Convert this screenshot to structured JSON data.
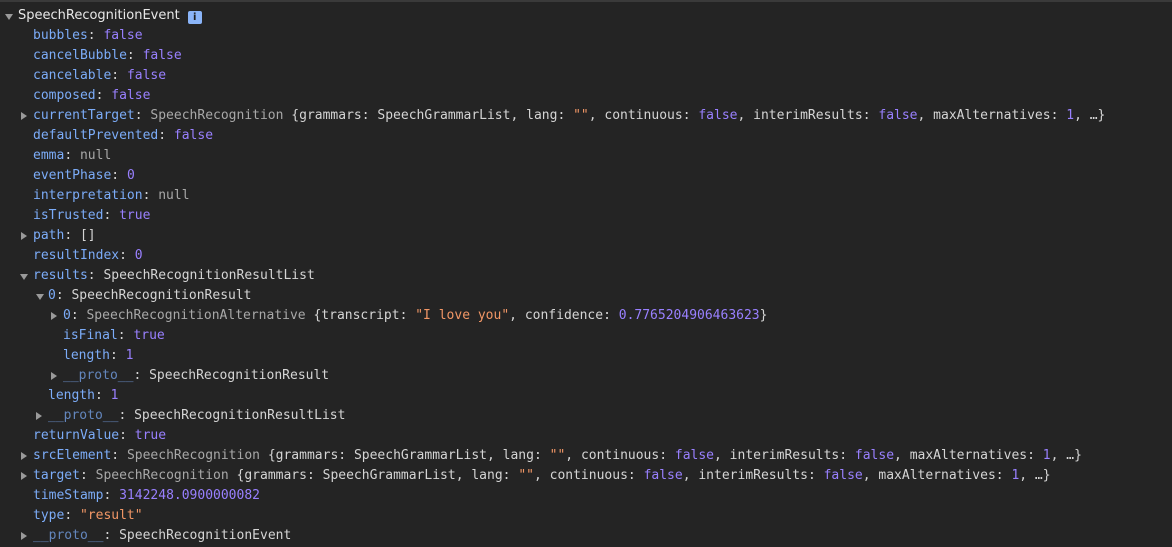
{
  "console": {
    "root": {
      "name": "SpeechRecognitionEvent",
      "info_icon": "i"
    },
    "rows": {
      "bubbles": {
        "key": "bubbles",
        "value": "false"
      },
      "cancelBubble": {
        "key": "cancelBubble",
        "value": "false"
      },
      "cancelable": {
        "key": "cancelable",
        "value": "false"
      },
      "composed": {
        "key": "composed",
        "value": "false"
      },
      "currentTarget": {
        "key": "currentTarget",
        "cls": "SpeechRecognition",
        "open": "{",
        "grammars_key": "grammars",
        "grammars_val": "SpeechGrammarList",
        "lang_key": "lang",
        "lang_val": "\"\"",
        "continuous_key": "continuous",
        "continuous_val": "false",
        "interim_key": "interimResults",
        "interim_val": "false",
        "maxalt_key": "maxAlternatives",
        "maxalt_val": "1",
        "tail": ", …}"
      },
      "defaultPrevented": {
        "key": "defaultPrevented",
        "value": "false"
      },
      "emma": {
        "key": "emma",
        "value": "null"
      },
      "eventPhase": {
        "key": "eventPhase",
        "value": "0"
      },
      "interpretation": {
        "key": "interpretation",
        "value": "null"
      },
      "isTrusted": {
        "key": "isTrusted",
        "value": "true"
      },
      "path": {
        "key": "path",
        "value": "[]"
      },
      "resultIndex": {
        "key": "resultIndex",
        "value": "0"
      },
      "results": {
        "key": "results",
        "value": "SpeechRecognitionResultList"
      },
      "result0": {
        "key": "0",
        "value": "SpeechRecognitionResult"
      },
      "alt0": {
        "key": "0",
        "cls": "SpeechRecognitionAlternative",
        "open": "{",
        "transcript_key": "transcript",
        "transcript_val": "\"I love you\"",
        "confidence_key": "confidence",
        "confidence_val": "0.7765204906463623",
        "close": "}"
      },
      "isFinal": {
        "key": "isFinal",
        "value": "true"
      },
      "length_inner": {
        "key": "length",
        "value": "1"
      },
      "proto_result": {
        "key": "__proto__",
        "value": "SpeechRecognitionResult"
      },
      "length_list": {
        "key": "length",
        "value": "1"
      },
      "proto_list": {
        "key": "__proto__",
        "value": "SpeechRecognitionResultList"
      },
      "returnValue": {
        "key": "returnValue",
        "value": "true"
      },
      "srcElement": {
        "key": "srcElement",
        "cls": "SpeechRecognition",
        "open": "{",
        "grammars_key": "grammars",
        "grammars_val": "SpeechGrammarList",
        "lang_key": "lang",
        "lang_val": "\"\"",
        "continuous_key": "continuous",
        "continuous_val": "false",
        "interim_key": "interimResults",
        "interim_val": "false",
        "maxalt_key": "maxAlternatives",
        "maxalt_val": "1",
        "tail": ", …}"
      },
      "target": {
        "key": "target",
        "cls": "SpeechRecognition",
        "open": "{",
        "grammars_key": "grammars",
        "grammars_val": "SpeechGrammarList",
        "lang_key": "lang",
        "lang_val": "\"\"",
        "continuous_key": "continuous",
        "continuous_val": "false",
        "interim_key": "interimResults",
        "interim_val": "false",
        "maxalt_key": "maxAlternatives",
        "maxalt_val": "1",
        "tail": ", …}"
      },
      "timeStamp": {
        "key": "timeStamp",
        "value": "3142248.0900000082"
      },
      "type": {
        "key": "type",
        "value": "\"result\""
      },
      "proto_event": {
        "key": "__proto__",
        "value": "SpeechRecognitionEvent"
      }
    },
    "colors": {
      "background": "#242424",
      "key": "#7cacf8",
      "keyword": "#9980ff",
      "string": "#f29766",
      "null": "#a8a8a8"
    }
  }
}
